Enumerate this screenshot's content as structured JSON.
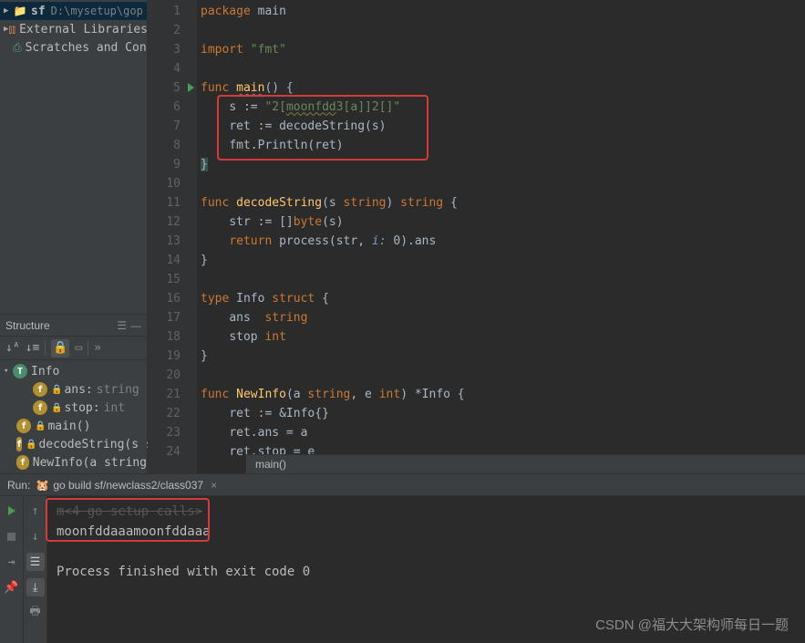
{
  "project": {
    "root_name": "sf",
    "root_path": "D:\\mysetup\\gop",
    "ext_libs": "External Libraries",
    "scratches": "Scratches and Cons"
  },
  "structure": {
    "title": "Structure",
    "nodes": {
      "info": "Info",
      "ans": "ans:",
      "ans_type": "string",
      "stop": "stop:",
      "stop_type": "int",
      "main": "main()",
      "decode": "decodeString(s s",
      "newinfo": "NewInfo(a string"
    }
  },
  "code": {
    "l1": "package main",
    "l3": "import \"fmt\"",
    "l5": "func main() {",
    "l6": "    s := \"2[moonfdd3[a]]2[]\"",
    "l7": "    ret := decodeString(s)",
    "l8": "    fmt.Println(ret)",
    "l9": "}",
    "l11": "func decodeString(s string) string {",
    "l12": "    str := []byte(s)",
    "l13_a": "    return process(str, ",
    "l13_hint": "i: ",
    "l13_b": "0).ans",
    "l14": "}",
    "l16": "type Info struct {",
    "l17": "    ans  string",
    "l18": "    stop int",
    "l19": "}",
    "l21": "func NewInfo(a string, e int) *Info {",
    "l22": "    ret := &Info{}",
    "l23": "    ret.ans = a",
    "l24": "    ret.stop = e"
  },
  "breadcrumb": "main()",
  "run": {
    "label": "Run:",
    "config": "go build sf/newclass2/class037",
    "out_dim": "m<4 go setup calls>",
    "out_line": "moonfddaaamoonfddaaa",
    "exit": "Process finished with exit code 0"
  },
  "watermark": "CSDN @福大大架构师每日一题"
}
